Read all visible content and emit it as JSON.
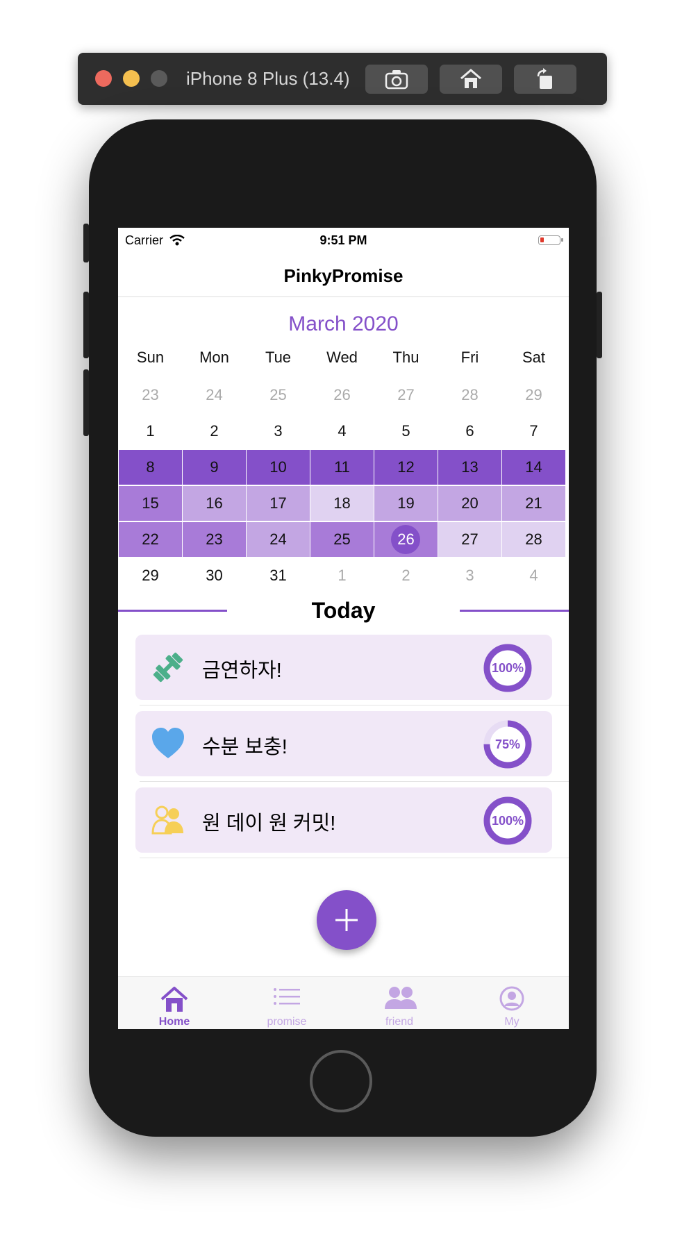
{
  "simulator": {
    "title": "iPhone 8 Plus (13.4)",
    "buttons": [
      "screenshot-icon",
      "home-icon",
      "rotate-icon"
    ]
  },
  "status_bar": {
    "carrier": "Carrier",
    "time": "9:51 PM",
    "battery_level": 0.1
  },
  "nav": {
    "title": "PinkyPromise"
  },
  "calendar": {
    "month_label": "March 2020",
    "weekdays": [
      "Sun",
      "Mon",
      "Tue",
      "Wed",
      "Thu",
      "Fri",
      "Sat"
    ],
    "weeks": [
      [
        {
          "d": "23",
          "dim": true
        },
        {
          "d": "24",
          "dim": true
        },
        {
          "d": "25",
          "dim": true
        },
        {
          "d": "26",
          "dim": true
        },
        {
          "d": "27",
          "dim": true
        },
        {
          "d": "28",
          "dim": true
        },
        {
          "d": "29",
          "dim": true
        }
      ],
      [
        {
          "d": "1"
        },
        {
          "d": "2"
        },
        {
          "d": "3"
        },
        {
          "d": "4"
        },
        {
          "d": "5"
        },
        {
          "d": "6"
        },
        {
          "d": "7"
        }
      ],
      [
        {
          "d": "8",
          "level": 4
        },
        {
          "d": "9",
          "level": 4
        },
        {
          "d": "10",
          "level": 4
        },
        {
          "d": "11",
          "level": 4
        },
        {
          "d": "12",
          "level": 4
        },
        {
          "d": "13",
          "level": 4
        },
        {
          "d": "14",
          "level": 4
        }
      ],
      [
        {
          "d": "15",
          "level": 3
        },
        {
          "d": "16",
          "level": 2
        },
        {
          "d": "17",
          "level": 2
        },
        {
          "d": "18",
          "level": 1
        },
        {
          "d": "19",
          "level": 2
        },
        {
          "d": "20",
          "level": 2
        },
        {
          "d": "21",
          "level": 2
        }
      ],
      [
        {
          "d": "22",
          "level": 3
        },
        {
          "d": "23",
          "level": 3
        },
        {
          "d": "24",
          "level": 2
        },
        {
          "d": "25",
          "level": 3
        },
        {
          "d": "26",
          "level": 3,
          "today": true
        },
        {
          "d": "27",
          "level": 1
        },
        {
          "d": "28",
          "level": 1
        }
      ],
      [
        {
          "d": "29"
        },
        {
          "d": "30"
        },
        {
          "d": "31"
        },
        {
          "d": "1",
          "dim": true
        },
        {
          "d": "2",
          "dim": true
        },
        {
          "d": "3",
          "dim": true
        },
        {
          "d": "4",
          "dim": true
        }
      ]
    ]
  },
  "today": {
    "heading": "Today",
    "items": [
      {
        "icon": "dumbbell-icon",
        "title": "금연하자!",
        "progress": 100,
        "progress_label": "100%"
      },
      {
        "icon": "heart-icon",
        "title": "수분 보충!",
        "progress": 75,
        "progress_label": "75%"
      },
      {
        "icon": "people-icon",
        "title": "원 데이 원 커밋!",
        "progress": 100,
        "progress_label": "100%"
      }
    ]
  },
  "fab": {
    "icon": "plus-icon"
  },
  "tabbar": {
    "tabs": [
      {
        "label": "Home",
        "icon": "home-icon",
        "selected": true
      },
      {
        "label": "promise",
        "icon": "list-icon"
      },
      {
        "label": "friend",
        "icon": "friends-icon"
      },
      {
        "label": "My",
        "icon": "profile-icon"
      }
    ]
  },
  "colors": {
    "accent": "#8450c9",
    "card_bg": "#f1e8f7",
    "dumbbell": "#4caf8a",
    "heart": "#5aa7ea",
    "people": "#f6cf57"
  }
}
